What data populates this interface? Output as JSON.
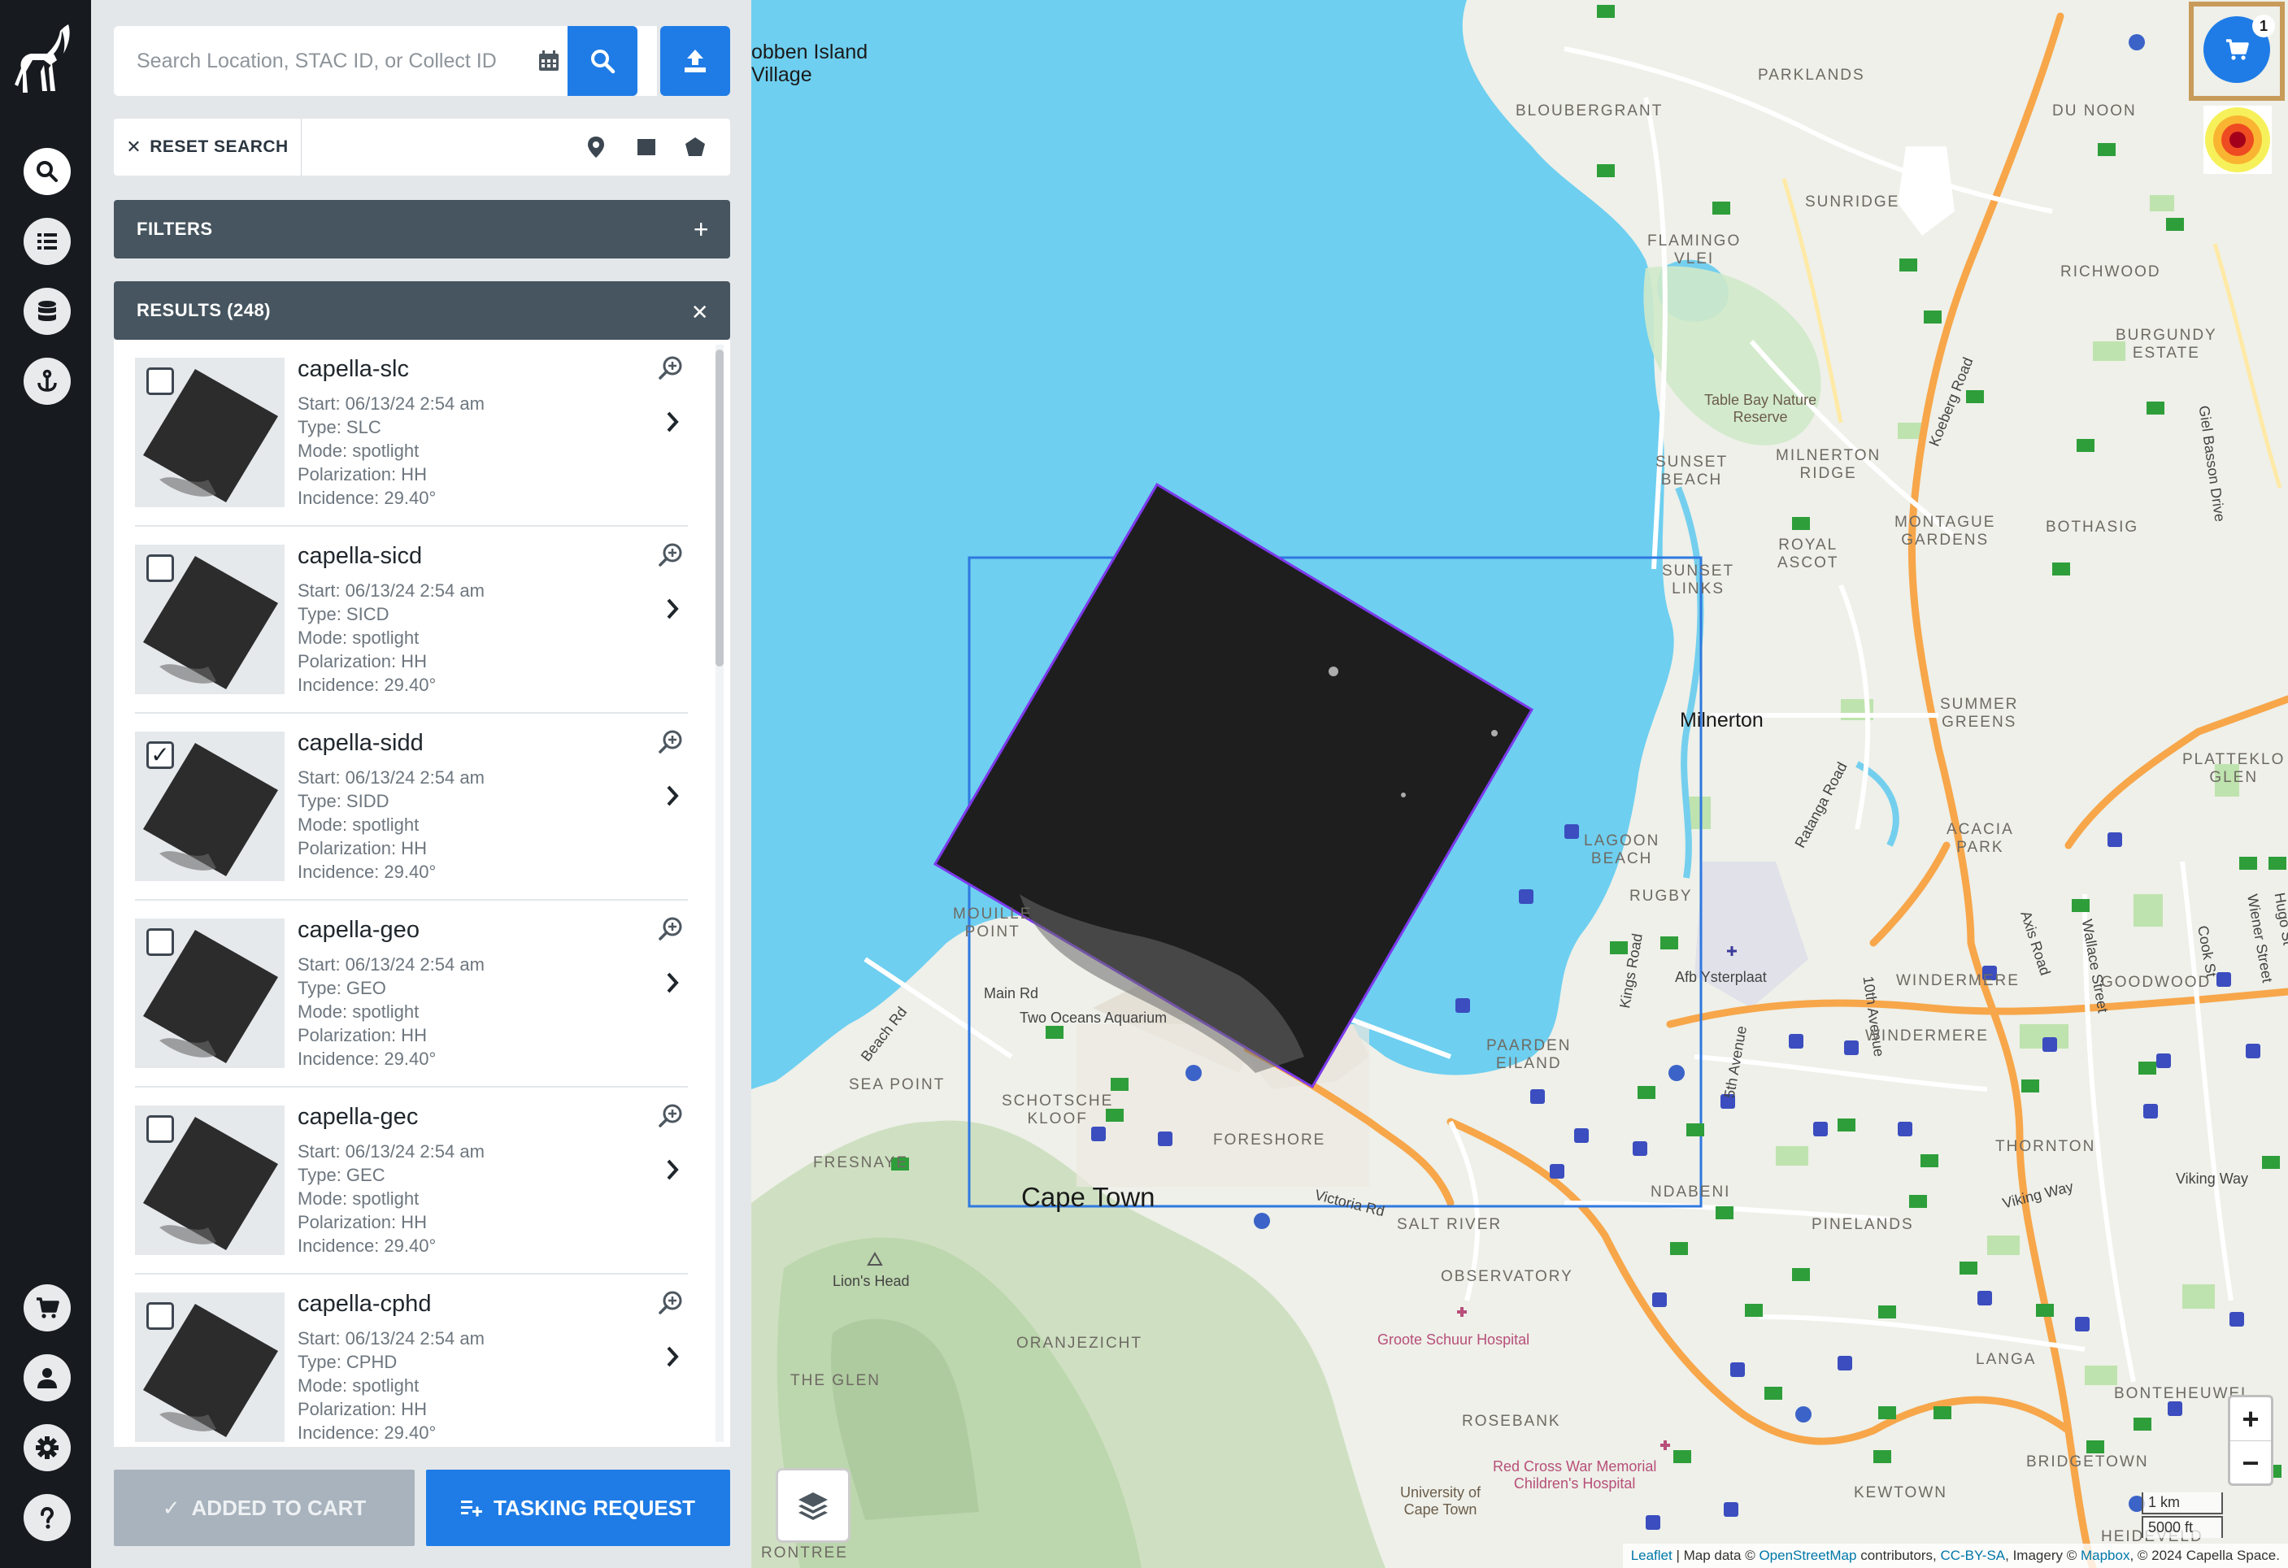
{
  "search": {
    "placeholder": "Search Location, STAC ID, or Collect ID",
    "reset_label": "RESET SEARCH"
  },
  "filters": {
    "label": "FILTERS"
  },
  "results": {
    "label": "RESULTS (248)",
    "items": [
      {
        "title": "capella-slc",
        "start": "Start: 06/13/24 2:54 am",
        "type": "Type: SLC",
        "mode": "Mode: spotlight",
        "polarization": "Polarization: HH",
        "incidence": "Incidence: 29.40°",
        "checked": false
      },
      {
        "title": "capella-sicd",
        "start": "Start: 06/13/24 2:54 am",
        "type": "Type: SICD",
        "mode": "Mode: spotlight",
        "polarization": "Polarization: HH",
        "incidence": "Incidence: 29.40°",
        "checked": false
      },
      {
        "title": "capella-sidd",
        "start": "Start: 06/13/24 2:54 am",
        "type": "Type: SIDD",
        "mode": "Mode: spotlight",
        "polarization": "Polarization: HH",
        "incidence": "Incidence: 29.40°",
        "checked": true
      },
      {
        "title": "capella-geo",
        "start": "Start: 06/13/24 2:54 am",
        "type": "Type: GEO",
        "mode": "Mode: spotlight",
        "polarization": "Polarization: HH",
        "incidence": "Incidence: 29.40°",
        "checked": false
      },
      {
        "title": "capella-gec",
        "start": "Start: 06/13/24 2:54 am",
        "type": "Type: GEC",
        "mode": "Mode: spotlight",
        "polarization": "Polarization: HH",
        "incidence": "Incidence: 29.40°",
        "checked": false
      },
      {
        "title": "capella-cphd",
        "start": "Start: 06/13/24 2:54 am",
        "type": "Type: CPHD",
        "mode": "Mode: spotlight",
        "polarization": "Polarization: HH",
        "incidence": "Incidence: 29.40°",
        "checked": false
      }
    ]
  },
  "actions": {
    "added_to_cart": "ADDED TO CART",
    "tasking_request": "TASKING REQUEST"
  },
  "cart": {
    "count": "1"
  },
  "map": {
    "labels": {
      "robben": "obben Island\nVillage",
      "parklands": "PARKLANDS",
      "bloubergrant": "BLOUBERGRANT",
      "du_noon": "DU NOON",
      "sunridge": "SUNRIDGE",
      "flamingo": "FLAMINGO\nVLEI",
      "richwood": "RICHWOOD",
      "burgundy": "BURGUNDY\nESTATE",
      "table_bay": "Table Bay Nature\nReserve",
      "keeberg": "Koeberg Road",
      "gie_basson": "Giel Basson Drive",
      "sunset_beach": "SUNSET\nBEACH",
      "milnerton_ridge": "MILNERTON\nRIDGE",
      "montague": "MONTAGUE\nGARDENS",
      "bothasig": "BOTHASIG",
      "royal_ascot": "ROYAL\nASCOT",
      "sunset_links": "SUNSET\nLINKS",
      "milnerton": "Milnerton",
      "summer_greens": "SUMMER\nGREENS",
      "plattekloof": "PLATTEKLO\nGLEN",
      "ratanga": "Ratanga Road",
      "lagoon_beach": "LAGOON\nBEACH",
      "acacia": "ACACIA\nPARK",
      "rugby": "RUGBY",
      "mouille": "MOUILLE\nPOINT",
      "main_rd": "Main Rd",
      "two_oceans": "Two Oceans Aquarium",
      "beach_rd": "Beach Rd",
      "kings_road": "Kings Road",
      "ysterplaat": "Afb Ysterplaat",
      "tenth_ave": "10th Avenue",
      "windermere1": "WINDERMERE",
      "windermere2": "WINDERMERE",
      "goodwood": "GOODWOOD",
      "axis_road": "Axis Road",
      "wallace": "Wallace Street",
      "cook_st": "Cook St",
      "wiener": "Wiener Street",
      "hugo": "Hugo St",
      "sea_point": "SEA POINT",
      "schotsche": "SCHOTSCHE\nKLOOF",
      "paarden": "PAARDEN\nEILAND",
      "fifth_ave": "5th Avenue",
      "fresnaye": "FRESNAYE",
      "foreshore": "FORESHORE",
      "thornton": "THORNTON",
      "viking_way1": "Viking Way",
      "viking_way2": "Viking Way",
      "cape_town": "Cape Town",
      "victoria_rd": "Victoria Rd",
      "ndabeni": "NDABENI",
      "salt_river": "SALT RIVER",
      "pinelands": "PINELANDS",
      "lions_head": "Lion's Head",
      "observatory": "OBSERVATORY",
      "groote_schuur": "Groote Schuur Hospital",
      "oranjezicht": "ORANJEZICHT",
      "langa": "LANGA",
      "the_glen": "THE GLEN",
      "bonteheuwel": "BONTEHEUWEL",
      "rosebank": "ROSEBANK",
      "bridgetown": "BRIDGETOWN",
      "red_cross": "Red Cross War Memorial\nChildren's Hospital",
      "uct": "University of\nCape Town",
      "kewtown": "KEWTOWN",
      "rontree": "RONTREE",
      "heideveld": "HEIDEVELD"
    },
    "scale_km": "1 km",
    "scale_ft": "5000 ft",
    "attribution": {
      "leaflet": "Leaflet",
      "text1": " | Map data © ",
      "osm": "OpenStreetMap",
      "text2": " contributors, ",
      "ccbysa": "CC-BY-SA",
      "text3": ", Imagery © ",
      "mapbox": "Mapbox",
      "text4": ", © 2024 Capella Space."
    }
  }
}
